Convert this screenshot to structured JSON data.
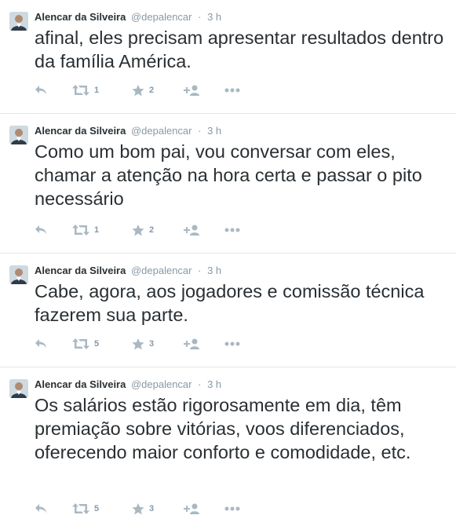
{
  "tweets": [
    {
      "fullname": "Alencar da Silveira",
      "username": "@depalencar",
      "separator": "·",
      "time": "3 h",
      "text": "afinal, eles precisam apresentar resultados dentro da família América.",
      "retweets": "1",
      "favorites": "2"
    },
    {
      "fullname": "Alencar da Silveira",
      "username": "@depalencar",
      "separator": "·",
      "time": "3 h",
      "text": "Como um bom pai, vou conversar com eles, chamar a atenção na hora certa e passar o pito necessário",
      "retweets": "1",
      "favorites": "2"
    },
    {
      "fullname": "Alencar da Silveira",
      "username": "@depalencar",
      "separator": "·",
      "time": "3 h",
      "text": "Cabe, agora, aos jogadores e comissão técnica fazerem sua parte.",
      "retweets": "5",
      "favorites": "3"
    },
    {
      "fullname": "Alencar da Silveira",
      "username": "@depalencar",
      "separator": "·",
      "time": "3 h",
      "text": "Os salários estão rigorosamente em dia, têm premiação sobre vitórias, voos diferenciados, oferecendo maior conforto e comodidade, etc.",
      "retweets": "5",
      "favorites": "3"
    }
  ],
  "icons": {
    "reply": "reply-icon",
    "retweet": "retweet-icon",
    "favorite": "star-icon",
    "follow": "follow-icon",
    "more": "more-icon"
  },
  "colors": {
    "text": "#292f33",
    "muted": "#8899a6",
    "icon": "#aab8c2",
    "divider": "#e1e8ed"
  }
}
